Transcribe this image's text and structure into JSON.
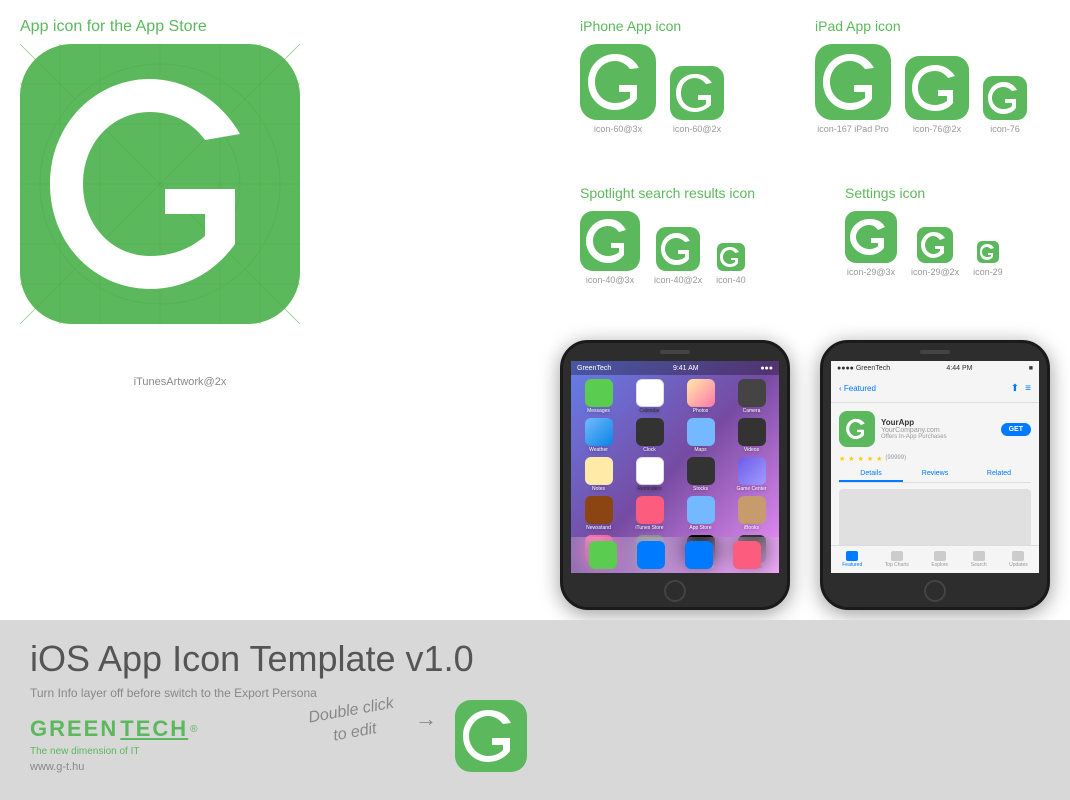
{
  "page": {
    "title": "iOS App Icon Template v1.0",
    "subtitle": "Turn Info layer off before switch to the Export Persona",
    "background_top": "#ffffff",
    "background_bottom": "#d8d8d8"
  },
  "app_store_section": {
    "label": "App icon for the App Store",
    "itunes_label": "iTunesArtwork@2x"
  },
  "iphone_section": {
    "title": "iPhone App icon",
    "icons": [
      {
        "size": 76,
        "label": "icon-60@3x"
      },
      {
        "size": 54,
        "label": "icon-60@2x"
      }
    ]
  },
  "ipad_section": {
    "title": "iPad App icon",
    "icons": [
      {
        "size": 76,
        "label": "icon-167 iPad Pro"
      },
      {
        "size": 64,
        "label": "icon-76@2x"
      },
      {
        "size": 44,
        "label": "icon-76"
      }
    ]
  },
  "spotlight_section": {
    "title": "Spotlight search results icon",
    "icons": [
      {
        "size": 60,
        "label": "icon-40@3x"
      },
      {
        "size": 44,
        "label": "icon-40@2x"
      },
      {
        "size": 28,
        "label": "icon-40"
      }
    ]
  },
  "settings_section": {
    "title": "Settings icon",
    "icons": [
      {
        "size": 52,
        "label": "icon-29@3x"
      },
      {
        "size": 36,
        "label": "icon-29@2x"
      },
      {
        "size": 22,
        "label": "icon-29"
      }
    ]
  },
  "brand": {
    "name": "GREENTECH",
    "trademark": "®",
    "tagline": "The new dimension of IT",
    "website": "www.g-t.hu"
  },
  "double_click": {
    "text": "Double click\nto edit",
    "arrow": "→"
  },
  "colors": {
    "green": "#5cb85c",
    "dark_green": "#4cae4c",
    "text_gray": "#888888",
    "title_gray": "#555555"
  }
}
